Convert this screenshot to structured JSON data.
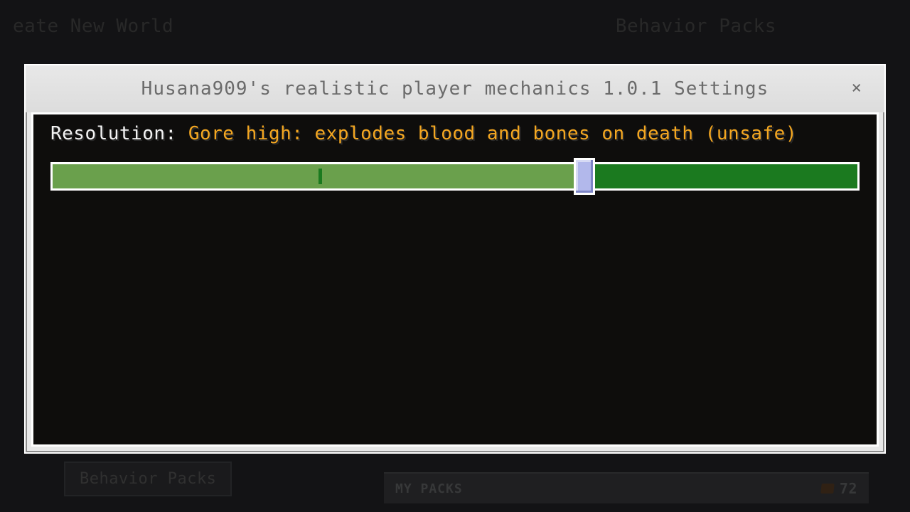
{
  "background": {
    "title_left": "eate New World",
    "title_right": "Behavior Packs",
    "bottom_left_label": "Behavior Packs",
    "my_packs_label": "MY PACKS",
    "my_packs_count": "72"
  },
  "modal": {
    "title": "Husana909's realistic player mechanics 1.0.1 Settings",
    "close_glyph": "×"
  },
  "setting": {
    "label_key": "Resolution:",
    "label_value": "Gore high: explodes blood and bones on death (unsafe)",
    "slider": {
      "percent": 66,
      "tick_percent": 33
    }
  },
  "colors": {
    "accent_orange": "#f4a721",
    "slider_fill": "#6aa04c",
    "slider_track": "#1b7a1f",
    "thumb": "#b2b8eb"
  }
}
